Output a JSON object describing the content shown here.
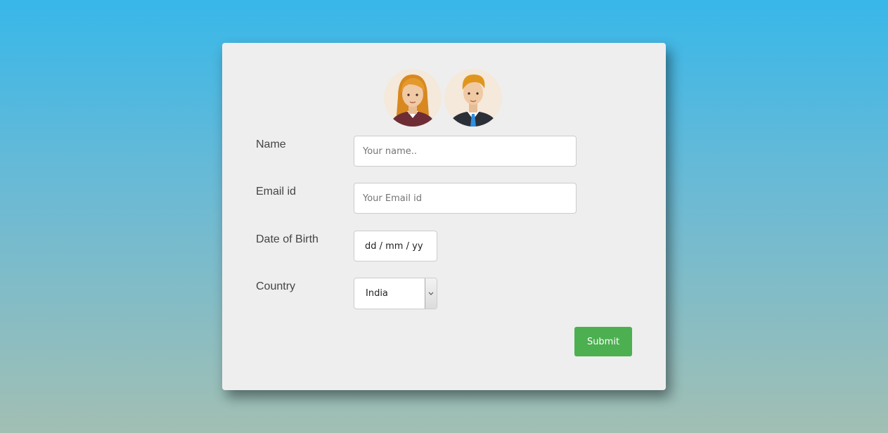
{
  "form": {
    "name": {
      "label": "Name",
      "placeholder": "Your name.."
    },
    "email": {
      "label": "Email id",
      "placeholder": "Your Email id"
    },
    "dob": {
      "label": "Date of Birth",
      "value": "dd / mm / yy"
    },
    "country": {
      "label": "Country",
      "selected": "India"
    },
    "submit_label": "Submit"
  },
  "avatars": [
    "female-avatar-icon",
    "male-avatar-icon"
  ],
  "colors": {
    "submit": "#4caf50",
    "card": "#eeeeee"
  }
}
